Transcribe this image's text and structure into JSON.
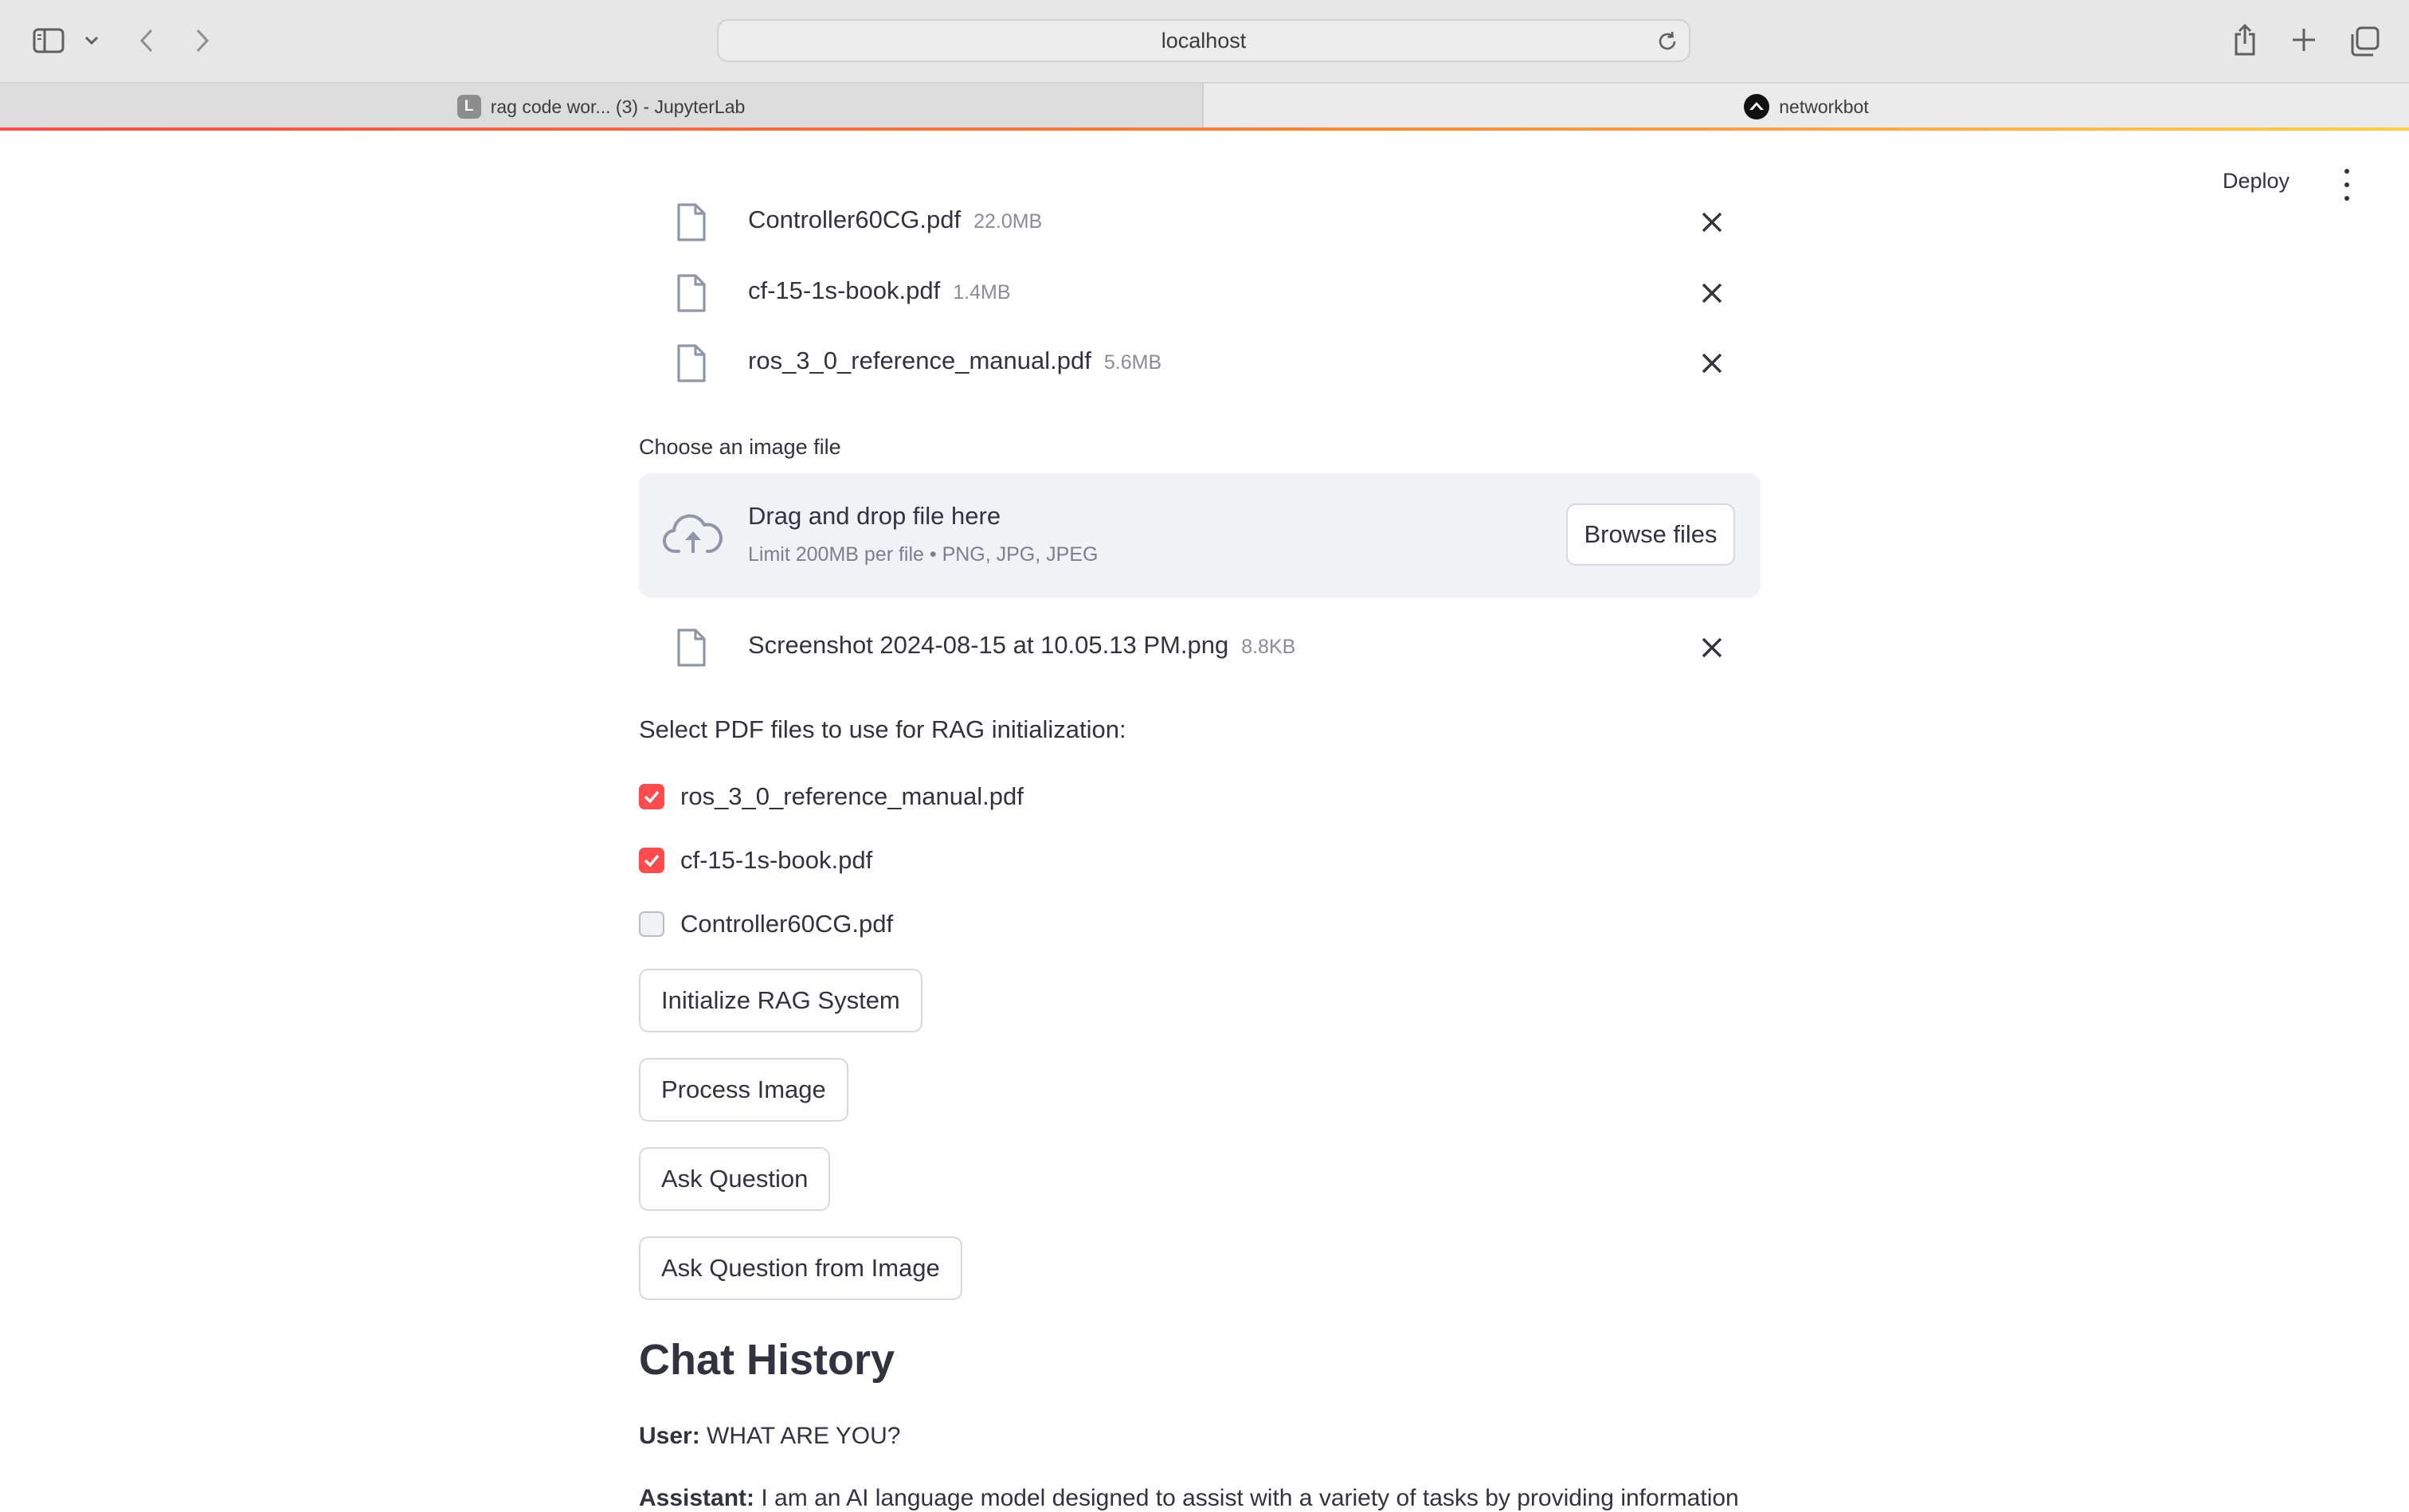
{
  "browser": {
    "url": "localhost",
    "tabs": [
      {
        "badge": "L",
        "title": "rag code wor... (3) - JupyterLab"
      },
      {
        "title": "networkbot"
      }
    ],
    "icons": [
      "sidebar-icon",
      "chevron-down-icon",
      "back-icon",
      "forward-icon",
      "reload-icon",
      "share-icon",
      "new-tab-icon",
      "tab-overview-icon"
    ]
  },
  "app": {
    "deploy_label": "Deploy",
    "pdf_files": [
      {
        "name": "Controller60CG.pdf",
        "size": "22.0MB"
      },
      {
        "name": "cf-15-1s-book.pdf",
        "size": "1.4MB"
      },
      {
        "name": "ros_3_0_reference_manual.pdf",
        "size": "5.6MB"
      }
    ],
    "image_uploader": {
      "label": "Choose an image file",
      "title": "Drag and drop file here",
      "hint": "Limit 200MB per file • PNG, JPG, JPEG",
      "browse_label": "Browse files",
      "file": {
        "name": "Screenshot 2024-08-15 at 10.05.13 PM.png",
        "size": "8.8KB"
      }
    },
    "select_label": "Select PDF files to use for RAG initialization:",
    "checkboxes": [
      {
        "label": "ros_3_0_reference_manual.pdf",
        "checked": true
      },
      {
        "label": "cf-15-1s-book.pdf",
        "checked": true
      },
      {
        "label": "Controller60CG.pdf",
        "checked": false
      }
    ],
    "buttons": {
      "init": "Initialize RAG System",
      "process": "Process Image",
      "ask": "Ask Question",
      "ask_image": "Ask Question from Image"
    },
    "chat": {
      "heading": "Chat History",
      "messages": [
        {
          "role": "User:",
          "text": "WHAT ARE YOU?"
        },
        {
          "role": "Assistant:",
          "text": "I am an AI language model designed to assist with a variety of tasks by providing information"
        }
      ]
    },
    "colors": {
      "accent": "#ff4b4b",
      "text": "#31333f",
      "surface": "#f0f2f6"
    }
  }
}
